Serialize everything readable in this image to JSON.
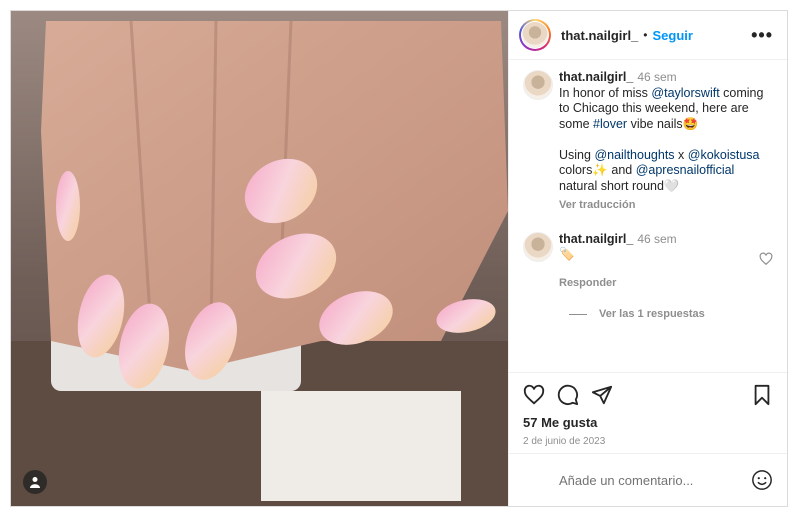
{
  "post": {
    "username": "that.nailgirl_",
    "follow_label": "Seguir",
    "separator": "•",
    "more_label": "•••"
  },
  "caption": {
    "username": "that.nailgirl_",
    "time": "46 sem",
    "t1": "In honor of miss ",
    "mention1": "@taylorswift",
    "t2": " coming to Chicago this weekend, here are some ",
    "hashtag": "#lover",
    "t3": " vibe nails🤩",
    "t4": "Using ",
    "mention2": "@nailthoughts",
    "t5": " x ",
    "mention3": "@kokoistusa",
    "t6": " colors✨ and ",
    "mention4": "@apresnailofficial",
    "t7": " natural short round🤍",
    "translate_label": "Ver traducción"
  },
  "comment": {
    "username": "that.nailgirl_",
    "time": "46 sem",
    "text": "🏷️",
    "reply_label": "Responder",
    "view_replies": "Ver las 1 respuestas"
  },
  "likes": "57 Me gusta",
  "date": "2 de junio de 2023",
  "add_comment_placeholder": "Añade un comentario...",
  "icons": [
    "heart-icon",
    "comment-icon",
    "share-icon",
    "bookmark-icon",
    "emoji-icon",
    "user-tag-icon"
  ],
  "colors": {
    "accent": "#0095f6",
    "mention": "#00376b",
    "muted": "#8e8e8e"
  }
}
